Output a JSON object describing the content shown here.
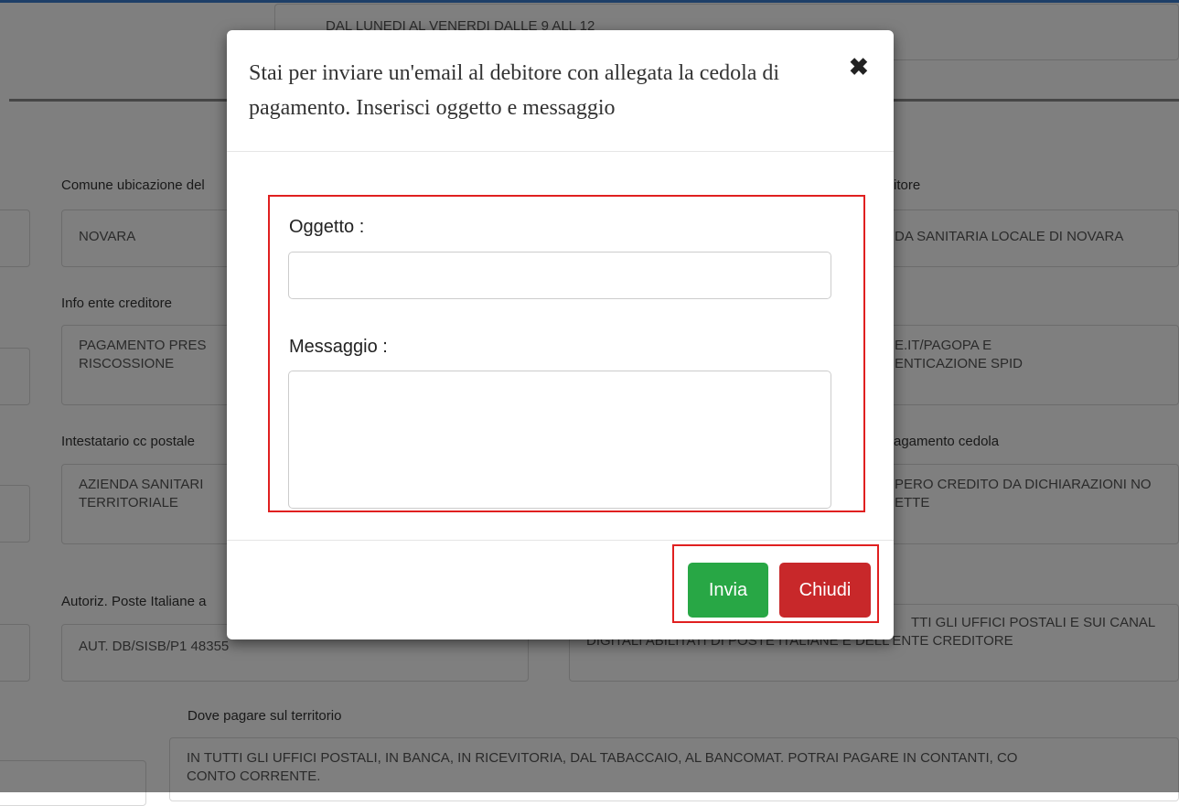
{
  "background": {
    "top_field_text": "DAL LUNEDI AL VENERDI DALLE 9 ALL 12",
    "labels": {
      "comune": "Comune ubicazione del",
      "ente": "itore",
      "info_ente": "Info ente creditore",
      "intestatario": "Intestatario cc postale",
      "pagamento": "agamento cedola",
      "autoriz": "Autoriz. Poste Italiane a",
      "dove_pagare": "Dove pagare sul territorio"
    },
    "fields": {
      "comune": "NOVARA",
      "ente": "DA SANITARIA LOCALE DI NOVARA",
      "info_ente_1": "PAGAMENTO PRES",
      "info_ente_2": "RISCOSSIONE",
      "info_right_1": "E.IT/PAGOPA E",
      "info_right_2": "ENTICAZIONE SPID",
      "intestatario_1": "AZIENDA SANITARI",
      "intestatario_2": "TERRITORIALE",
      "pagamento_1": "PERO CREDITO DA DICHIARAZIONI NO",
      "pagamento_2": "ETTE",
      "autoriz": "AUT. DB/SISB/P1 48355",
      "canali_1": "TTI GLI UFFICI POSTALI E SUI CANAL",
      "canali_2": "DIGITALI ABILITATI DI POSTE ITALIANE E DELL'ENTE CREDITORE",
      "dove_1": "IN TUTTI GLI UFFICI POSTALI, IN BANCA, IN RICEVITORIA, DAL TABACCAIO, AL BANCOMAT. POTRAI PAGARE IN CONTANTI, CO",
      "dove_2": "CONTO CORRENTE."
    }
  },
  "modal": {
    "title": "Stai per inviare un'email al debitore con allegata la cedola di pagamento. Inserisci oggetto e messaggio",
    "close_symbol": "✖",
    "oggetto_label": "Oggetto :",
    "oggetto_value": "",
    "messaggio_label": "Messaggio :",
    "messaggio_value": "",
    "invia_label": "Invia",
    "chiudi_label": "Chiudi"
  },
  "colors": {
    "overlay": "rgba(0,0,0,0.5)",
    "highlight_border": "#e02020",
    "invia_button": "#28a745",
    "chiudi_button": "#c8282a"
  }
}
